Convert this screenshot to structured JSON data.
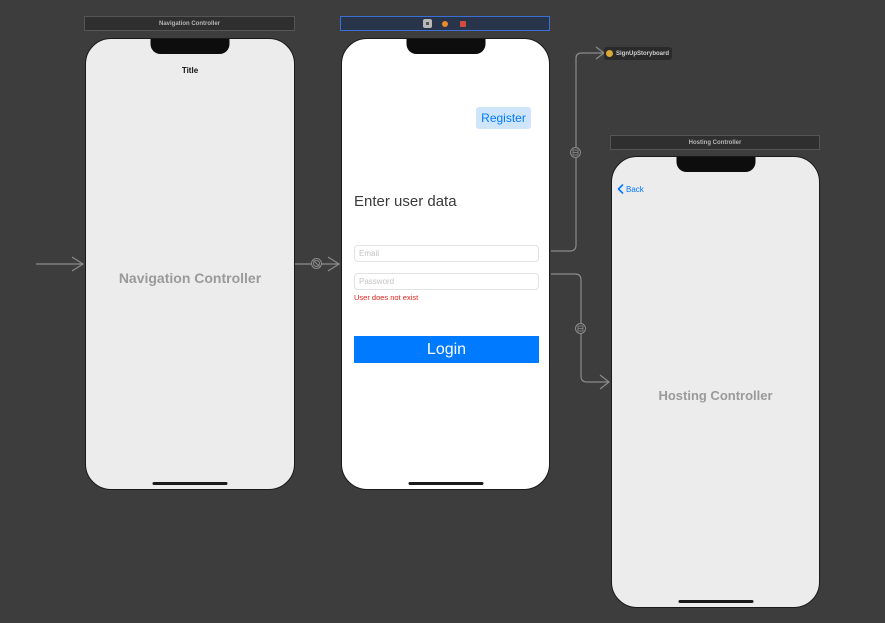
{
  "nav_controller": {
    "bar_title": "Navigation Controller",
    "nav_title": "Title",
    "center_label": "Navigation Controller"
  },
  "login_scene": {
    "register_label": "Register",
    "heading": "Enter user data",
    "email_placeholder": "Email",
    "password_placeholder": "Password",
    "error_text": "User does not exist",
    "login_label": "Login"
  },
  "storyboard_reference": {
    "label": "SignUpStoryboard"
  },
  "hosting_controller": {
    "bar_title": "Hosting Controller",
    "back_label": "Back",
    "center_label": "Hosting Controller"
  },
  "colors": {
    "canvas": "#3d3d3d",
    "accent": "#007aff",
    "error": "#e0231b",
    "selection": "#3b6fd6"
  }
}
